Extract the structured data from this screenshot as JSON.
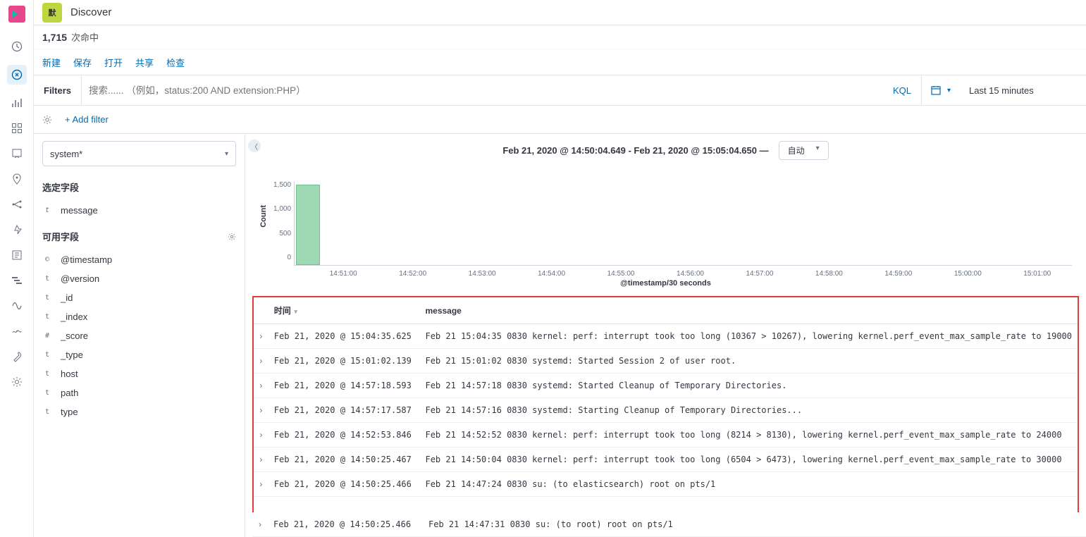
{
  "app": {
    "badge": "默",
    "title": "Discover"
  },
  "hits": {
    "count": "1,715",
    "label": "次命中"
  },
  "menu": {
    "new": "新建",
    "save": "保存",
    "open": "打开",
    "share": "共享",
    "inspect": "检查"
  },
  "search": {
    "filters_label": "Filters",
    "placeholder": "搜索...... （例如，status:200 AND extension:PHP）",
    "kql": "KQL",
    "daterange": "Last 15 minutes",
    "add_filter": "+ Add filter"
  },
  "fields": {
    "index_pattern": "system*",
    "selected_label": "选定字段",
    "selected": [
      {
        "type": "t",
        "name": "message"
      }
    ],
    "available_label": "可用字段",
    "available": [
      {
        "type": "©",
        "name": "@timestamp"
      },
      {
        "type": "t",
        "name": "@version"
      },
      {
        "type": "t",
        "name": "_id"
      },
      {
        "type": "t",
        "name": "_index"
      },
      {
        "type": "#",
        "name": "_score"
      },
      {
        "type": "t",
        "name": "_type"
      },
      {
        "type": "t",
        "name": "host"
      },
      {
        "type": "t",
        "name": "path"
      },
      {
        "type": "t",
        "name": "type"
      }
    ]
  },
  "timebar": {
    "range": "Feb 21, 2020 @ 14:50:04.649 - Feb 21, 2020 @ 15:05:04.650 —",
    "auto": "自动"
  },
  "chart_data": {
    "type": "bar",
    "categories": [
      "14:51:00",
      "14:52:00",
      "14:53:00",
      "14:54:00",
      "14:55:00",
      "14:56:00",
      "14:57:00",
      "14:58:00",
      "14:59:00",
      "15:00:00",
      "15:01:00"
    ],
    "values": [
      1715,
      0,
      0,
      0,
      0,
      0,
      0,
      0,
      0,
      0,
      0
    ],
    "yticks": [
      "1,500",
      "1,000",
      "500",
      "0"
    ],
    "ylabel": "Count",
    "xlabel": "@timestamp/30 seconds",
    "ylim": [
      0,
      1800
    ]
  },
  "table": {
    "col_time": "时间",
    "col_msg": "message",
    "rows": [
      {
        "time": "Feb 21, 2020 @ 15:04:35.625",
        "msg": "Feb 21 15:04:35 0830 kernel: perf: interrupt took too long (10367 > 10267), lowering kernel.perf_event_max_sample_rate to 19000"
      },
      {
        "time": "Feb 21, 2020 @ 15:01:02.139",
        "msg": "Feb 21 15:01:02 0830 systemd: Started Session 2 of user root."
      },
      {
        "time": "Feb 21, 2020 @ 14:57:18.593",
        "msg": "Feb 21 14:57:18 0830 systemd: Started Cleanup of Temporary Directories."
      },
      {
        "time": "Feb 21, 2020 @ 14:57:17.587",
        "msg": "Feb 21 14:57:16 0830 systemd: Starting Cleanup of Temporary Directories..."
      },
      {
        "time": "Feb 21, 2020 @ 14:52:53.846",
        "msg": "Feb 21 14:52:52 0830 kernel: perf: interrupt took too long (8214 > 8130), lowering kernel.perf_event_max_sample_rate to 24000"
      },
      {
        "time": "Feb 21, 2020 @ 14:50:25.467",
        "msg": "Feb 21 14:50:04 0830 kernel: perf: interrupt took too long (6504 > 6473), lowering kernel.perf_event_max_sample_rate to 30000"
      },
      {
        "time": "Feb 21, 2020 @ 14:50:25.466",
        "msg": "Feb 21 14:47:24 0830 su: (to elasticsearch) root on pts/1"
      }
    ],
    "extra": {
      "time": "Feb 21, 2020 @ 14:50:25.466",
      "msg": "Feb 21 14:47:31 0830 su: (to root) root on pts/1"
    }
  }
}
